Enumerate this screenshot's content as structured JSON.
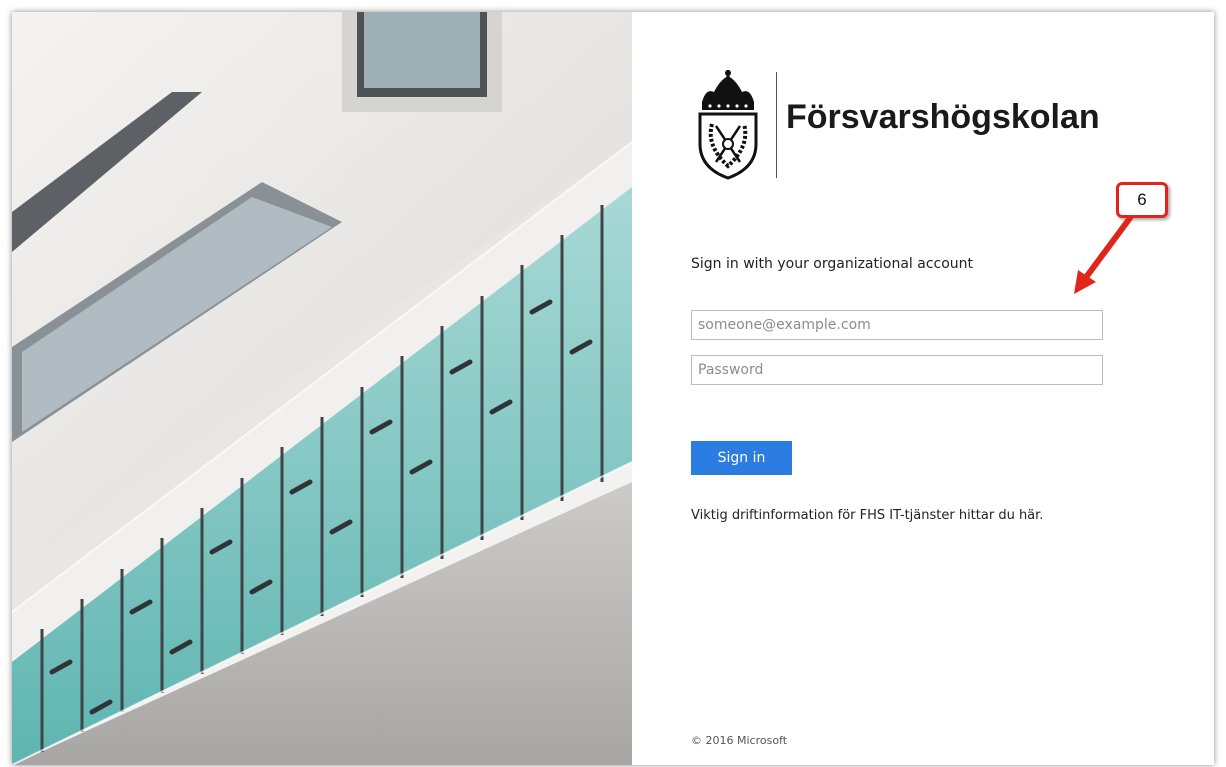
{
  "brand": {
    "name": "Försvarshögskolan",
    "crest_icon": "royal-crown-crest-icon"
  },
  "signin": {
    "heading": "Sign in with your organizational account",
    "username_placeholder": "someone@example.com",
    "password_placeholder": "Password",
    "button_label": "Sign in",
    "button_color": "#2b7de1",
    "info_text": "Viktig driftinformation för FHS IT-tjänster hittar du här."
  },
  "footer": {
    "copyright": "© 2016 Microsoft"
  },
  "annotation": {
    "step_number": "6",
    "color": "#e0261b",
    "arrow_icon": "red-arrow-icon"
  },
  "illustration": {
    "subject": "building-facade-image"
  }
}
